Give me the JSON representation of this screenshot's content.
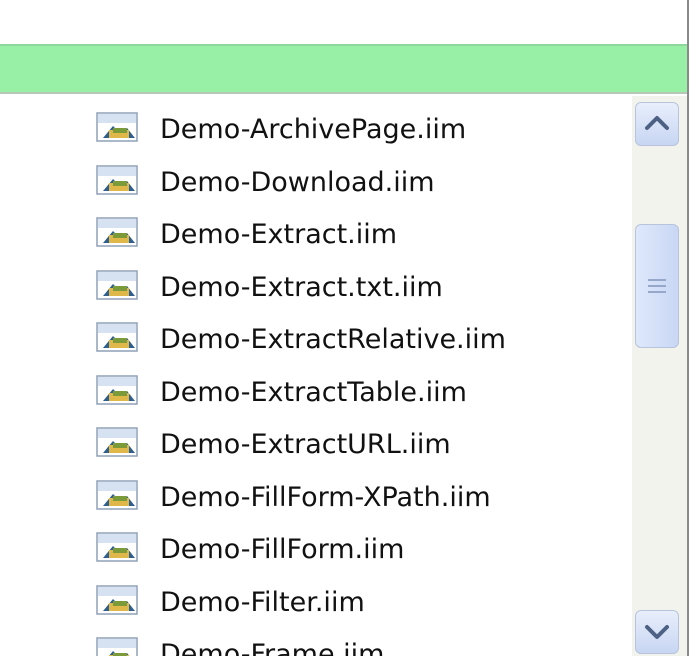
{
  "files": [
    {
      "name": "Demo-ArchivePage.iim",
      "icon": "macro-file-icon"
    },
    {
      "name": "Demo-Download.iim",
      "icon": "macro-file-icon"
    },
    {
      "name": "Demo-Extract.iim",
      "icon": "macro-file-icon"
    },
    {
      "name": "Demo-Extract.txt.iim",
      "icon": "macro-file-icon"
    },
    {
      "name": "Demo-ExtractRelative.iim",
      "icon": "macro-file-icon"
    },
    {
      "name": "Demo-ExtractTable.iim",
      "icon": "macro-file-icon"
    },
    {
      "name": "Demo-ExtractURL.iim",
      "icon": "macro-file-icon"
    },
    {
      "name": "Demo-FillForm-XPath.iim",
      "icon": "macro-file-icon"
    },
    {
      "name": "Demo-FillForm.iim",
      "icon": "macro-file-icon"
    },
    {
      "name": "Demo-Filter.iim",
      "icon": "macro-file-icon"
    },
    {
      "name": "Demo-Frame.iim",
      "icon": "macro-file-icon"
    }
  ],
  "colors": {
    "selection_bar": "#98f0a6",
    "scrollbar_track": "#f3f3ee",
    "scrollbar_button": "#c8d6f3"
  },
  "scrollbar": {
    "up_icon": "chevron-up-icon",
    "down_icon": "chevron-down-icon"
  }
}
